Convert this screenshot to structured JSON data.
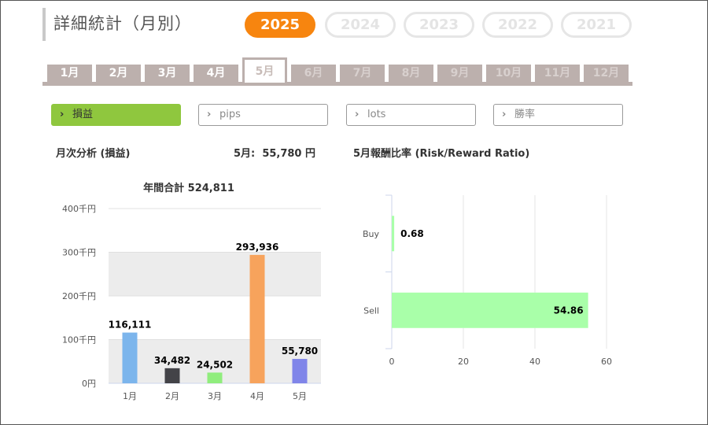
{
  "page": {
    "title": "詳細統計（月別）"
  },
  "years": [
    {
      "label": "2025",
      "active": true
    },
    {
      "label": "2024",
      "active": false
    },
    {
      "label": "2023",
      "active": false
    },
    {
      "label": "2022",
      "active": false
    },
    {
      "label": "2021",
      "active": false
    }
  ],
  "months": [
    {
      "label": "1月",
      "state": "enabled"
    },
    {
      "label": "2月",
      "state": "enabled"
    },
    {
      "label": "3月",
      "state": "enabled"
    },
    {
      "label": "4月",
      "state": "enabled"
    },
    {
      "label": "5月",
      "state": "active"
    },
    {
      "label": "6月",
      "state": "disabled"
    },
    {
      "label": "7月",
      "state": "disabled"
    },
    {
      "label": "8月",
      "state": "disabled"
    },
    {
      "label": "9月",
      "state": "disabled"
    },
    {
      "label": "10月",
      "state": "disabled"
    },
    {
      "label": "11月",
      "state": "disabled"
    },
    {
      "label": "12月",
      "state": "disabled"
    }
  ],
  "filters": [
    {
      "label": "損益",
      "active": true
    },
    {
      "label": "pips",
      "active": false
    },
    {
      "label": "lots",
      "active": false
    },
    {
      "label": "勝率",
      "active": false
    }
  ],
  "left_panel": {
    "heading": "月次分析 (損益)",
    "month_prefix": "5月:",
    "month_value": "55,780 円"
  },
  "right_panel": {
    "heading": "5月報酬比率 (Risk/Reward Ratio)"
  },
  "colors": {
    "accent_orange": "#f7850f",
    "filter_active_green": "#8fc73e",
    "tab_gray": "#bcb0ad"
  },
  "chart_data": [
    {
      "type": "bar",
      "title": "年間合計 524,811",
      "categories": [
        "1月",
        "2月",
        "3月",
        "4月",
        "5月"
      ],
      "values": [
        116111,
        34482,
        24502,
        293936,
        55780
      ],
      "data_labels": [
        "116,111",
        "34,482",
        "24,502",
        "293,936",
        "55,780"
      ],
      "colors": [
        "#7cb5ec",
        "#434348",
        "#90ed7d",
        "#f7a35c",
        "#8085e9"
      ],
      "ylim": [
        0,
        400000
      ],
      "y_ticks": [
        0,
        100000,
        200000,
        300000,
        400000
      ],
      "y_tick_labels": [
        "0円",
        "100千円",
        "200千円",
        "300千円",
        "400千円"
      ],
      "grid": true,
      "alternate_band_color": "#ececec"
    },
    {
      "type": "bar",
      "orientation": "horizontal",
      "categories": [
        "Buy",
        "Sell"
      ],
      "values": [
        0.68,
        54.86
      ],
      "data_labels": [
        "0.68",
        "54.86"
      ],
      "colors": [
        "#a9ffa9",
        "#a9ffa9"
      ],
      "xlim": [
        0,
        60
      ],
      "x_ticks": [
        0,
        20,
        40,
        60
      ],
      "x_tick_labels": [
        "0",
        "20",
        "40",
        "60"
      ],
      "grid": true
    }
  ]
}
